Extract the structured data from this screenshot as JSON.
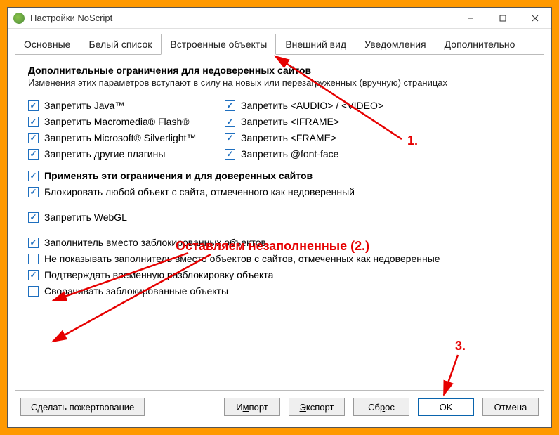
{
  "window": {
    "title": "Настройки NoScript"
  },
  "tabs": {
    "t0": "Основные",
    "t1": "Белый список",
    "t2": "Встроенные объекты",
    "t3": "Внешний вид",
    "t4": "Уведомления",
    "t5": "Дополнительно"
  },
  "panel": {
    "heading": "Дополнительные ограничения для недоверенных сайтов",
    "subheading": "Изменения этих параметров вступают в силу на новых или перезагруженных (вручную) страницах",
    "col1": {
      "java": "Запретить Java™",
      "flash": "Запретить Macromedia® Flash®",
      "silverlight": "Запретить Microsoft® Silverlight™",
      "plugins": "Запретить другие плагины"
    },
    "col2": {
      "audio": "Запретить <AUDIO> / <VIDEO>",
      "iframe": "Запретить <IFRAME>",
      "frame": "Запретить <FRAME>",
      "fontface": "Запретить @font-face"
    },
    "apply_trusted": "Применять эти ограничения и для доверенных сайтов",
    "block_untrusted": "Блокировать любой объект с сайта, отмеченного как недоверенный",
    "webgl": "Запретить WebGL",
    "placeholder": "Заполнитель вместо заблокированных объектов",
    "no_placeholder": "Не показывать заполнитель вместо объектов с сайтов, отмеченных как недоверенные",
    "confirm_unblock": "Подтверждать временную разблокировку объекта",
    "collapse": "Сворачивать заблокированные объекты"
  },
  "buttons": {
    "donate": "Сделать пожертвование",
    "import_pre": "И",
    "import_u": "м",
    "import_post": "порт",
    "export_pre": "",
    "export_u": "Э",
    "export_post": "кспорт",
    "reset_pre": "Сб",
    "reset_u": "р",
    "reset_post": "ос",
    "ok": "OK",
    "cancel": "Отмена"
  },
  "annotations": {
    "a1": "1.",
    "a2": "Оставляем незаполненные (2.)",
    "a3": "3."
  }
}
